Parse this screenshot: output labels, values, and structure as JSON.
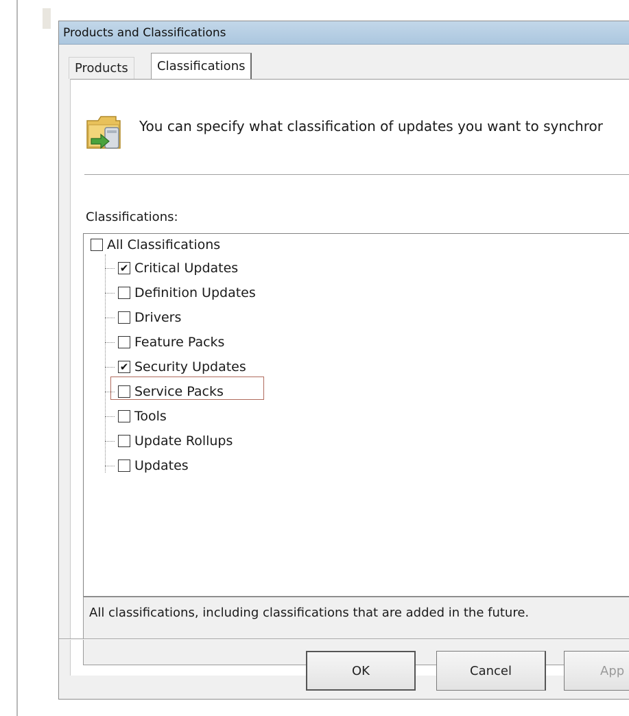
{
  "window": {
    "title": "Products and Classifications"
  },
  "tabs": [
    {
      "label": "Products",
      "selected": false
    },
    {
      "label": "Classifications",
      "selected": true
    }
  ],
  "info": {
    "text": "You can specify what classification of updates you want to synchror",
    "icon": "folder-sync-icon"
  },
  "classifications_label": "Classifications:",
  "tree": {
    "root": {
      "label": "All Classifications",
      "checked": false
    },
    "items": [
      {
        "label": "Critical Updates",
        "checked": true
      },
      {
        "label": "Definition Updates",
        "checked": false
      },
      {
        "label": "Drivers",
        "checked": false
      },
      {
        "label": "Feature Packs",
        "checked": false
      },
      {
        "label": "Security Updates",
        "checked": true
      },
      {
        "label": "Service Packs",
        "checked": false,
        "highlighted": true
      },
      {
        "label": "Tools",
        "checked": false
      },
      {
        "label": "Update Rollups",
        "checked": false
      },
      {
        "label": "Updates",
        "checked": false
      }
    ]
  },
  "description": "All classifications, including classifications that are added in the future.",
  "buttons": {
    "ok": "OK",
    "cancel": "Cancel",
    "apply": "App"
  },
  "colors": {
    "titlebar": "#b7cee4",
    "highlight": "#b06a5c"
  }
}
